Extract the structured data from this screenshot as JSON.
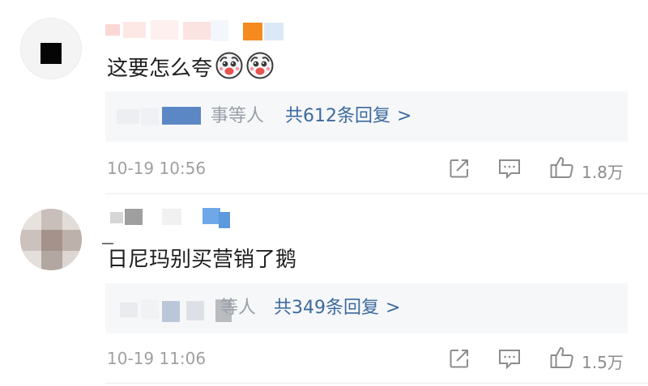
{
  "comments": [
    {
      "text": "这要怎么夸",
      "emoji_names": [
        "laughing-dog-emoji",
        "laughing-dog-emoji"
      ],
      "reply_names_suffix": "事等人",
      "reply_count_text": "共612条回复",
      "reply_arrow": ">",
      "time": "10-19 10:56",
      "likes": "1.8万"
    },
    {
      "text": "日尼玛别买营销了鹅",
      "reply_names_suffix": "等人",
      "reply_count_text": "共349条回复",
      "reply_arrow": ">",
      "time": "10-19 11:06",
      "likes": "1.5万"
    }
  ],
  "icons": {
    "share": "share-icon",
    "comment": "comment-icon",
    "like": "thumbs-up-icon"
  },
  "colors": {
    "reply_link": "#3c6a9e",
    "muted_text": "#a0a0a0",
    "reply_bg": "#f6f7f9"
  }
}
